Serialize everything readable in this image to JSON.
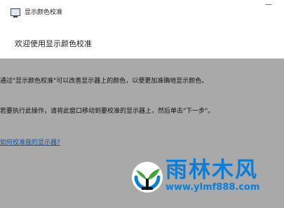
{
  "window": {
    "title": "显示颜色校准",
    "minimize_glyph": "—"
  },
  "header": {
    "title": "欢迎使用显示颜色校准"
  },
  "content": {
    "paragraph1": "通过\"显示颜色校准\"可以改善显示器上的颜色，以便更加准确地显示颜色。",
    "paragraph2": "若要执行此操作，请将此窗口移动到要校准的显示器上，然后单击\"下一步\"。",
    "help_link": "如何校准我的显示器?"
  },
  "watermark": {
    "name": "雨林木风",
    "url": "www.ylmf888.com",
    "logo_icon": "seedling-logo-icon",
    "colors": {
      "blue": "#0b7ed8",
      "green": "#3fa535",
      "black": "#111111"
    }
  }
}
